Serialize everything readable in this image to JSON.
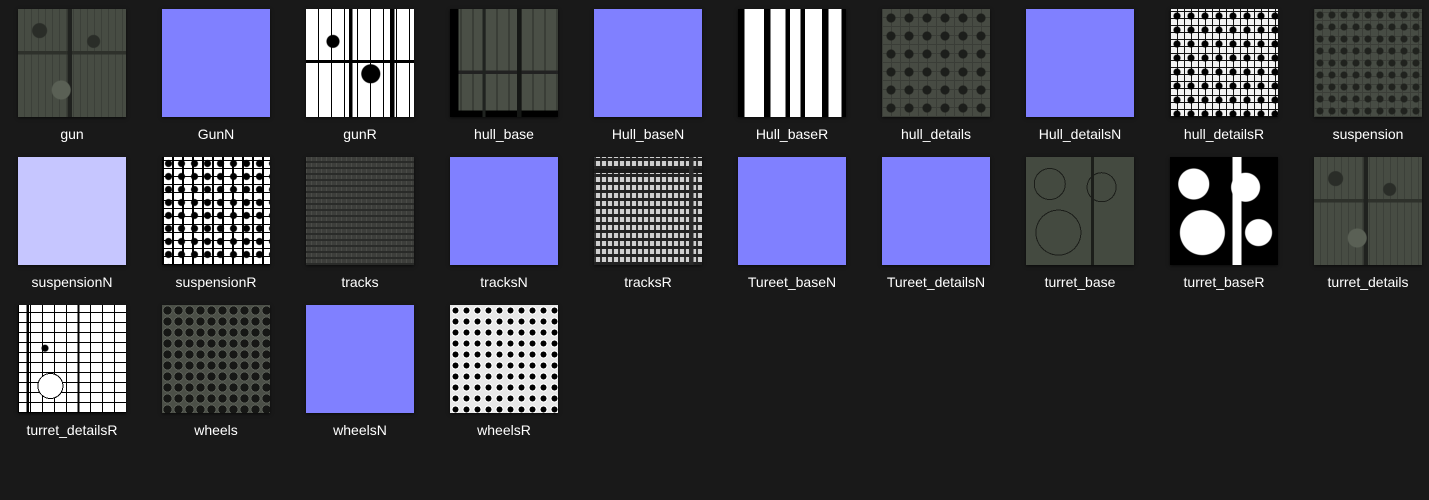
{
  "files": [
    {
      "name": "gun",
      "texture_icon": "texture-diffuse-icon",
      "texture_class": "diffuse-dark"
    },
    {
      "name": "GunN",
      "texture_icon": "texture-normal-icon",
      "texture_class": "normal-blue"
    },
    {
      "name": "gunR",
      "texture_icon": "texture-roughness-icon",
      "texture_class": "rough-bw"
    },
    {
      "name": "hull_base",
      "texture_icon": "texture-diffuse-icon",
      "texture_class": "diffuse-blocks"
    },
    {
      "name": "Hull_baseN",
      "texture_icon": "texture-normal-icon",
      "texture_class": "normal-blue"
    },
    {
      "name": "Hull_baseR",
      "texture_icon": "texture-roughness-icon",
      "texture_class": "rough-tall"
    },
    {
      "name": "hull_details",
      "texture_icon": "texture-diffuse-icon",
      "texture_class": "detail-grid"
    },
    {
      "name": "Hull_detailsN",
      "texture_icon": "texture-normal-icon",
      "texture_class": "normal-blue"
    },
    {
      "name": "hull_detailsR",
      "texture_icon": "texture-roughness-icon",
      "texture_class": "rough-detail"
    },
    {
      "name": "suspension",
      "texture_icon": "texture-diffuse-icon",
      "texture_class": "suspension-diffuse"
    },
    {
      "name": "suspensionN",
      "texture_icon": "texture-normal-icon",
      "texture_class": "normal-lavender"
    },
    {
      "name": "suspensionR",
      "texture_icon": "texture-roughness-icon",
      "texture_class": "suspension-rough"
    },
    {
      "name": "tracks",
      "texture_icon": "texture-diffuse-icon",
      "texture_class": "tracks-dark"
    },
    {
      "name": "tracksN",
      "texture_icon": "texture-normal-icon",
      "texture_class": "normal-blue"
    },
    {
      "name": "tracksR",
      "texture_icon": "texture-roughness-icon",
      "texture_class": "tracks-rough"
    },
    {
      "name": "Tureet_baseN",
      "texture_icon": "texture-normal-icon",
      "texture_class": "normal-blue"
    },
    {
      "name": "Tureet_detailsN",
      "texture_icon": "texture-normal-icon",
      "texture_class": "normal-blue"
    },
    {
      "name": "turret_base",
      "texture_icon": "texture-diffuse-icon",
      "texture_class": "turret-base"
    },
    {
      "name": "turret_baseR",
      "texture_icon": "texture-roughness-icon",
      "texture_class": "turret-base-rough"
    },
    {
      "name": "turret_details",
      "texture_icon": "texture-diffuse-icon",
      "texture_class": "diffuse-dark"
    },
    {
      "name": "turret_detailsR",
      "texture_icon": "texture-roughness-icon",
      "texture_class": "turret-details-rough"
    },
    {
      "name": "wheels",
      "texture_icon": "texture-diffuse-icon",
      "texture_class": "wheels-diffuse"
    },
    {
      "name": "wheelsN",
      "texture_icon": "texture-normal-icon",
      "texture_class": "normal-blue"
    },
    {
      "name": "wheelsR",
      "texture_icon": "texture-roughness-icon",
      "texture_class": "wheels-rough"
    }
  ],
  "colors": {
    "background": "#191919",
    "label_text": "#ffffff",
    "normal_map_blue": "#8080ff",
    "normal_map_lavender": "#c6c6ff"
  }
}
